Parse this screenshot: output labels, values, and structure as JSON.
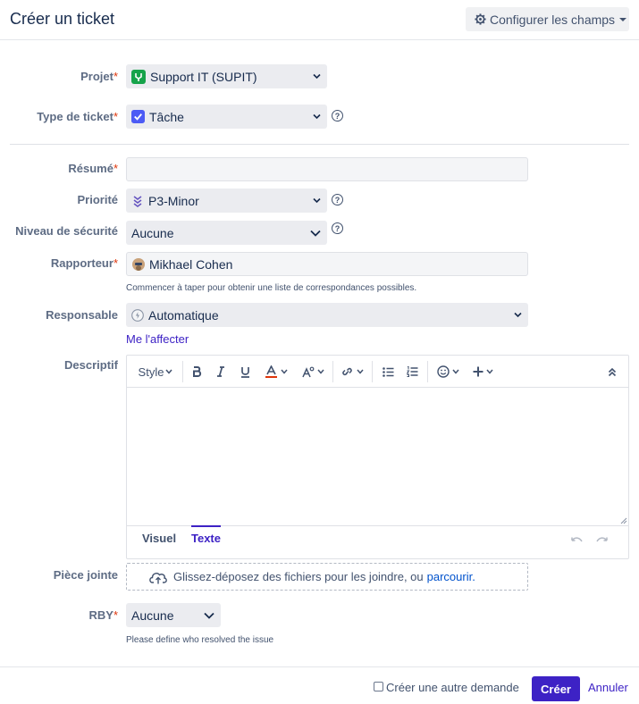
{
  "dialog": {
    "title": "Créer un ticket",
    "configure_label": "Configurer les champs"
  },
  "fields": {
    "project": {
      "label": "Projet",
      "value": "Support IT (SUPIT)"
    },
    "issue_type": {
      "label": "Type de ticket",
      "value": "Tâche"
    },
    "summary": {
      "label": "Résumé",
      "value": ""
    },
    "priority": {
      "label": "Priorité",
      "value": "P3-Minor"
    },
    "security": {
      "label": "Niveau de sécurité",
      "value": "Aucune"
    },
    "reporter": {
      "label": "Rapporteur",
      "value": "Mikhael Cohen",
      "hint": "Commencer à taper pour obtenir une liste de correspondances possibles."
    },
    "assignee": {
      "label": "Responsable",
      "value": "Automatique",
      "assign_me": "Me l'affecter"
    },
    "description": {
      "label": "Descriptif",
      "style_label": "Style",
      "tab_visual": "Visuel",
      "tab_text": "Texte"
    },
    "attachment": {
      "label": "Pièce jointe",
      "text": "Glissez-déposez des fichiers pour les joindre, ou",
      "browse": "parcourir."
    },
    "rby": {
      "label": "RBY",
      "value": "Aucune",
      "hint": "Please define who resolved the issue"
    }
  },
  "required_mark": "*",
  "help_mark": "?",
  "footer": {
    "create_another": "Créer une autre demande",
    "create": "Créer",
    "cancel": "Annuler"
  },
  "colors": {
    "primary": "#3d22c5",
    "required": "#de350b",
    "link": "#0052cc",
    "task_icon": "#4c5bf5",
    "project_icon": "#16a34a"
  }
}
